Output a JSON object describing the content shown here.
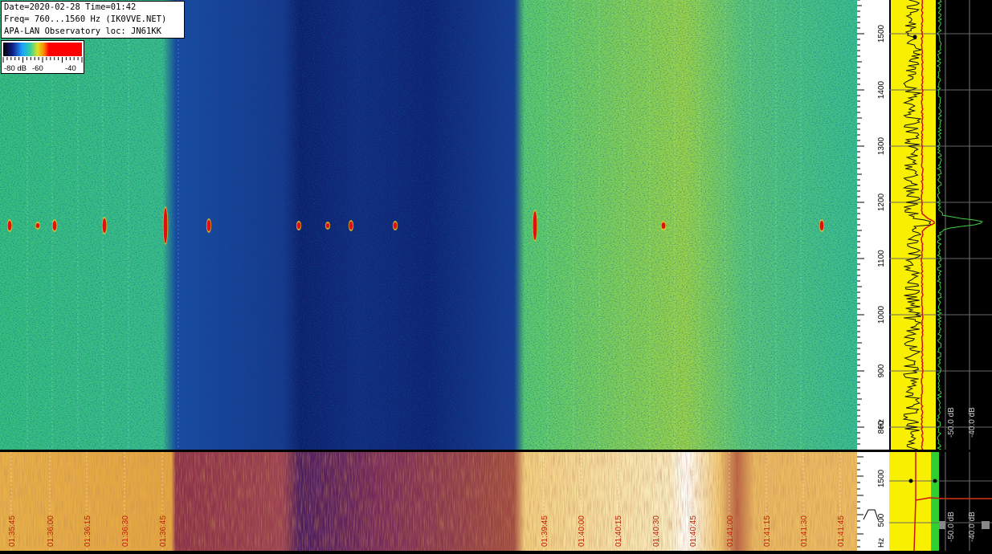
{
  "header": {
    "line1": "Date=2020-02-28 Time=01:42",
    "line2": "Freq= 760...1560 Hz (IK0VVE.NET)",
    "line3": "APA-LAN Observatory loc: JN61KK"
  },
  "color_scale": {
    "labels": [
      "-80 dB",
      "-60",
      "-40"
    ],
    "colors": [
      "#000000",
      "#1a2a8a",
      "#1aa0ff",
      "#30d0a0",
      "#e0e020",
      "#ff8000",
      "#ff0000"
    ]
  },
  "freq_axis_main": {
    "unit": "Hz",
    "ticks": [
      "1500",
      "1400",
      "1300",
      "1200",
      "1100",
      "1000",
      "900",
      "800"
    ]
  },
  "freq_axis_bottom": {
    "unit": "Hz",
    "ticks": [
      "1500",
      "500"
    ]
  },
  "spectrum_main": {
    "db_labels": [
      "-50.0 dB",
      "-40.0 dB"
    ]
  },
  "spectrum_bottom": {
    "db_labels": [
      "-50.0 dB",
      "-40.0 dB"
    ]
  },
  "time_axis": {
    "labels": [
      "01:35:45",
      "01:36:00",
      "01:36:15",
      "01:36:30",
      "01:36:45",
      "01:39:45",
      "01:40:00",
      "01:40:15",
      "01:40:30",
      "01:40:45",
      "01:41:00",
      "01:41:15",
      "01:41:30",
      "01:41:45"
    ]
  }
}
